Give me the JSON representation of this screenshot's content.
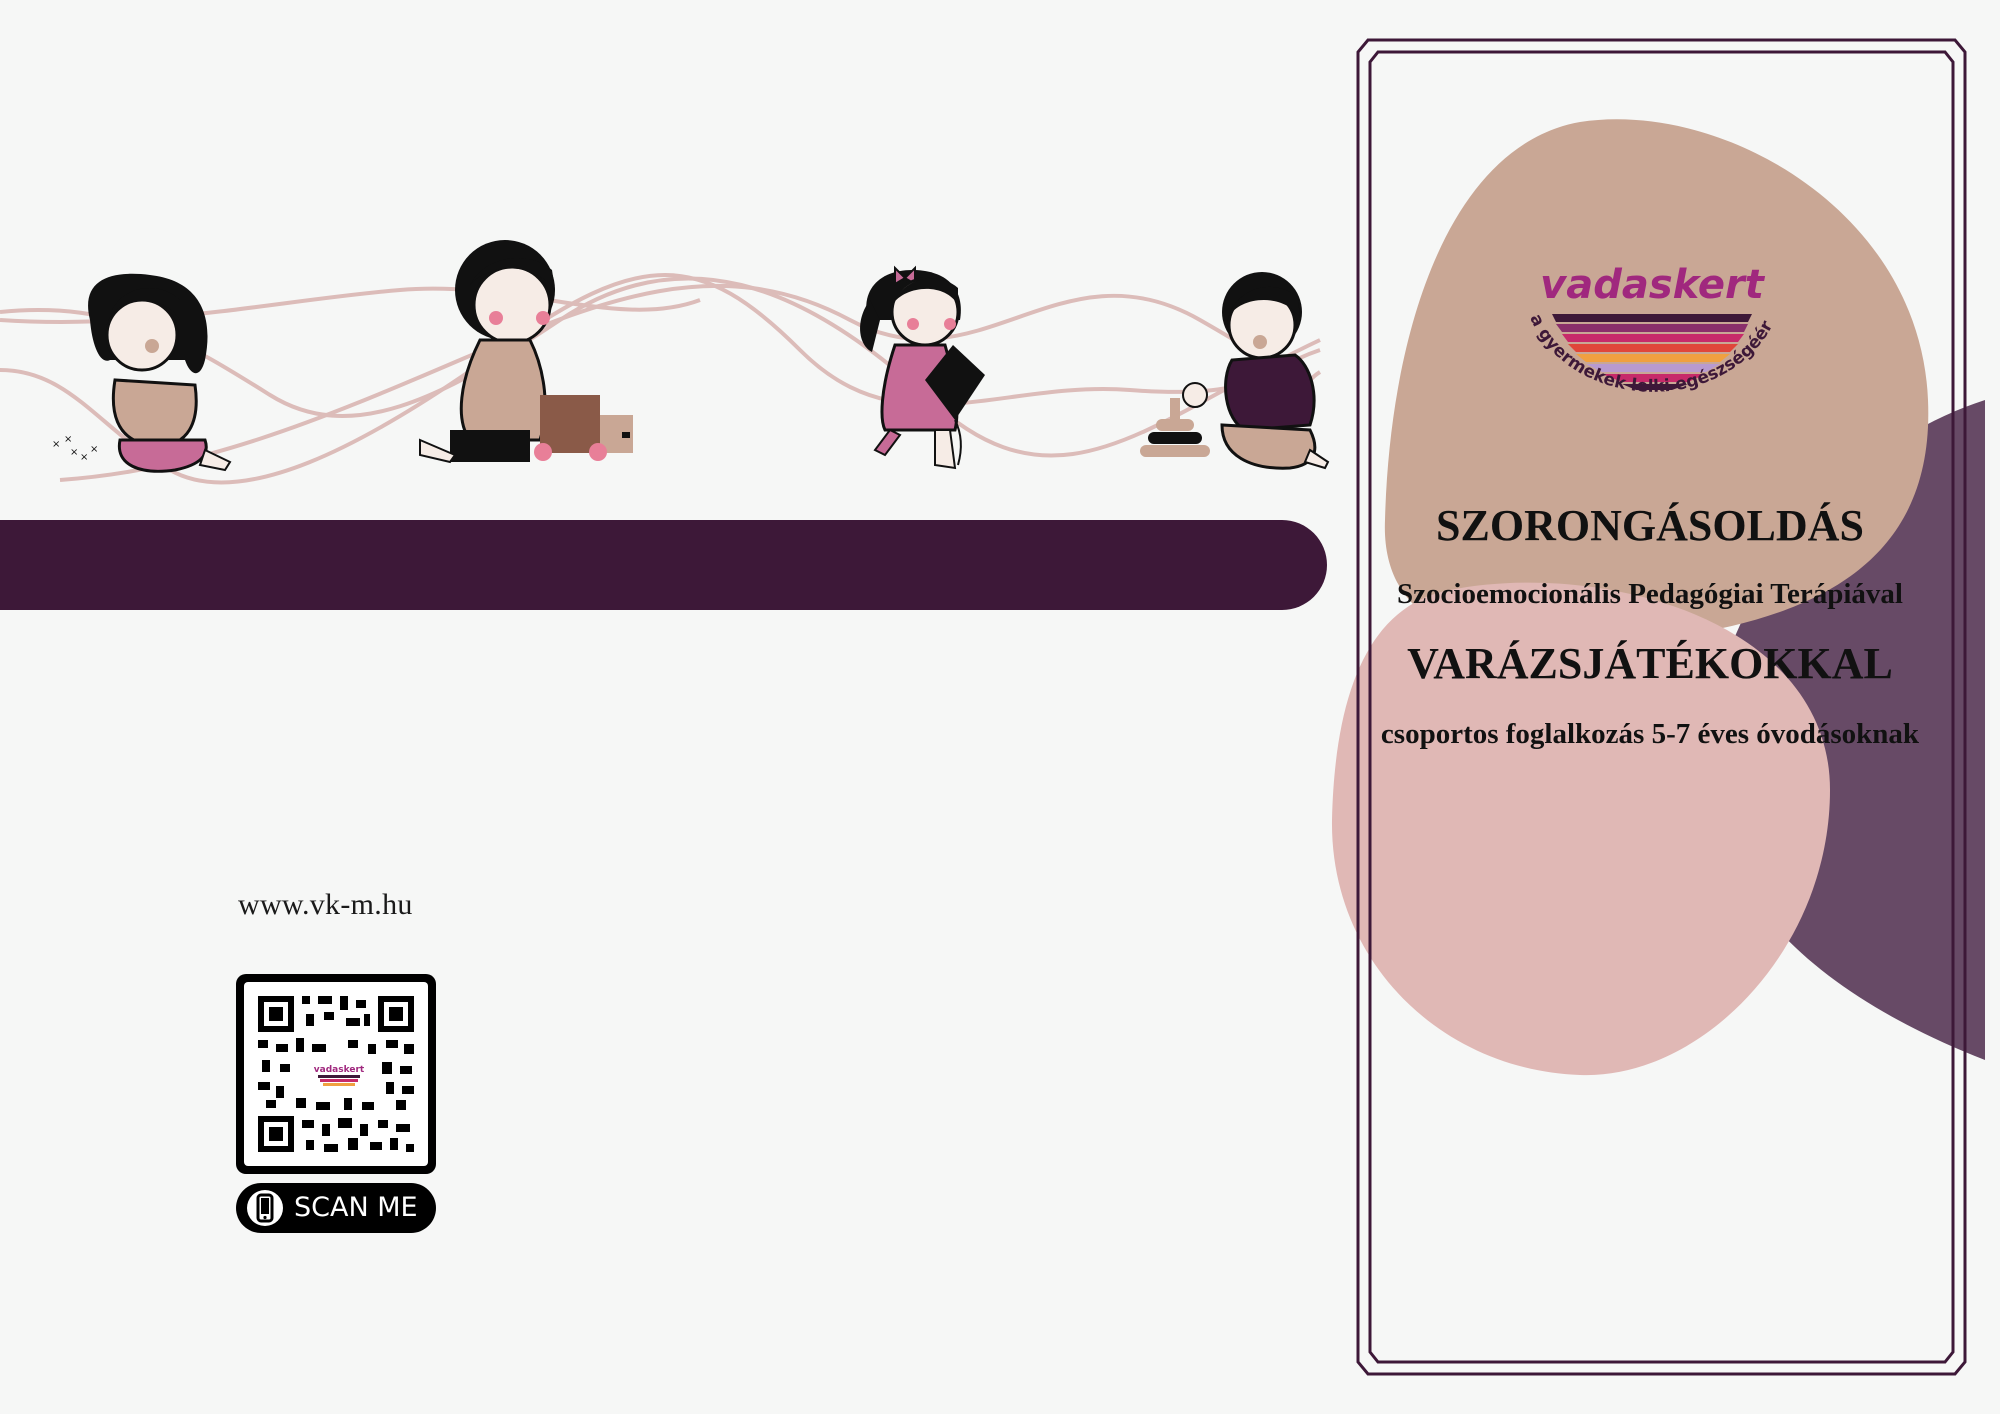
{
  "brand": {
    "name": "vadaskert",
    "tagline": "a gyermekek lelki egészségéért"
  },
  "titles": {
    "main": "SZORONGÁSOLDÁS",
    "subtitle": "Szocioemocionális Pedagógiai Terápiával",
    "secondary": "VARÁZSJÁTÉKOKKAL",
    "audience": "csoportos foglalkozás 5-7 éves óvodásoknak"
  },
  "contact": {
    "website": "www.vk-m.hu",
    "qr_label": "SCAN ME",
    "qr_logo_text": "vadaskert"
  },
  "colors": {
    "background": "#f6f7f6",
    "dark_plum": "#3d1838",
    "plum_blob": "#674a66",
    "tan_blob": "#c9a795",
    "pink_blob": "#e0b8b5",
    "brand_magenta": "#a0287e",
    "wave": "#dcbcb9"
  },
  "icons": [
    "phone-icon",
    "qr-code"
  ]
}
